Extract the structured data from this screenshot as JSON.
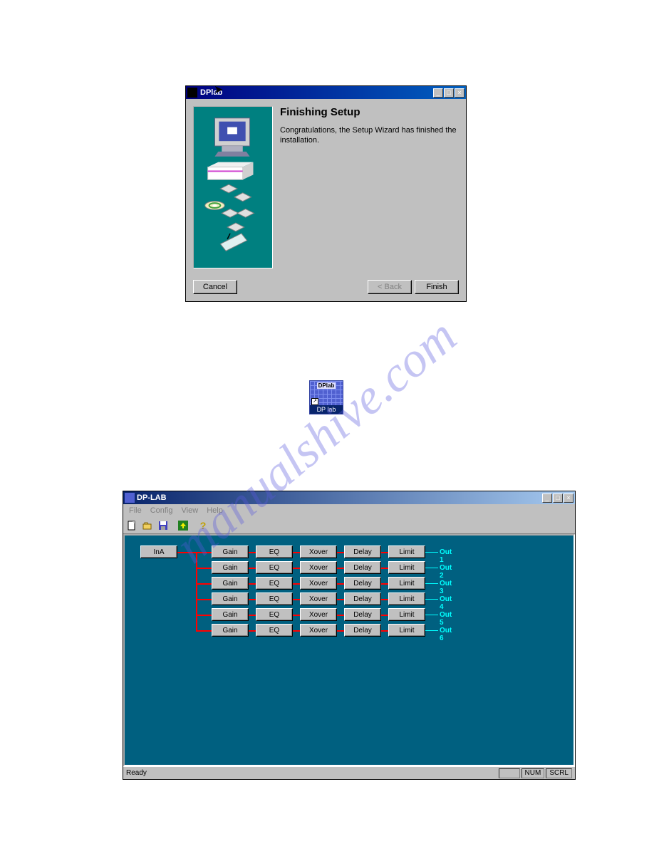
{
  "watermark_text": "manualshive.com",
  "setup_dialog": {
    "title": "DPlab",
    "heading": "Finishing Setup",
    "message": "Congratulations, the Setup Wizard has finished the installation.",
    "buttons": {
      "cancel": "Cancel",
      "back": "< Back",
      "finish": "Finish"
    }
  },
  "desktop_icon": {
    "top_label": "DPlab",
    "bottom_label": "DP lab"
  },
  "app_window": {
    "title": "DP-LAB",
    "menus": [
      "File",
      "Config",
      "View",
      "Help"
    ],
    "toolbar_icons": [
      "new-file-icon",
      "open-folder-icon",
      "save-icon",
      "up-arrow-icon",
      "help-icon"
    ],
    "input_label": "InA",
    "proc_labels": [
      "Gain",
      "EQ",
      "Xover",
      "Delay",
      "Limit"
    ],
    "outputs": [
      "Out 1",
      "Out 2",
      "Out 3",
      "Out 4",
      "Out 5",
      "Out 6"
    ],
    "statusbar": {
      "ready": "Ready",
      "num": "NUM",
      "scrl": "SCRL"
    }
  }
}
